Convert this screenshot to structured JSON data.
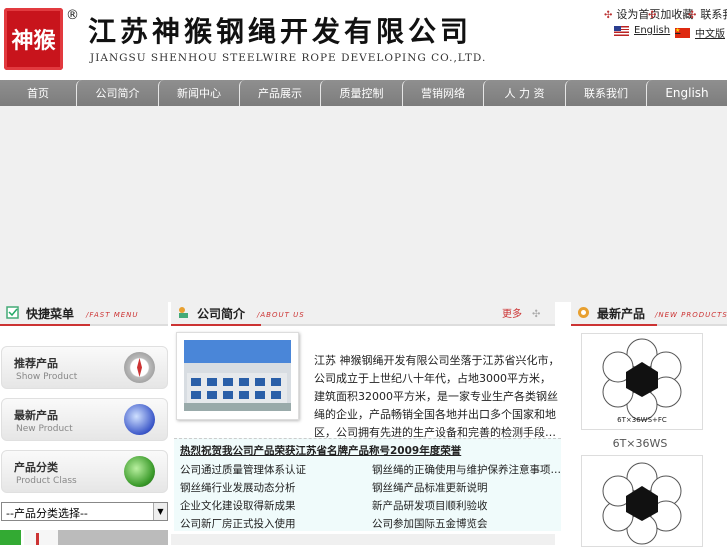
{
  "header": {
    "seal_text": "神猴",
    "reg_mark": "®",
    "company_cn": "江苏神猴钢绳开发有限公司",
    "company_en": "JIANGSU SHENHOU STEELWIRE ROPE DEVELOPING CO.,LTD.",
    "top_links": [
      "设为首页",
      "加收藏",
      "联系我们"
    ],
    "lang_en": "English",
    "lang_cn": "中文版"
  },
  "nav": {
    "items": [
      "首页",
      "公司简介",
      "新闻中心",
      "产品展示",
      "质量控制",
      "营销网络",
      "人 力 资",
      "联系我们"
    ],
    "english": "English"
  },
  "left": {
    "title": "快捷菜单",
    "subtitle": "/FAST MENU",
    "cards": [
      {
        "cn": "推荐产品",
        "en": "Show Product"
      },
      {
        "cn": "最新产品",
        "en": "New Product"
      },
      {
        "cn": "产品分类",
        "en": "Product Class"
      }
    ],
    "select_value": "--产品分类选择--"
  },
  "about": {
    "title": "公司简介",
    "subtitle": "/ABOUT US",
    "more": "更多",
    "text": "江苏 神猴钢绳开发有限公司坐落于江苏省兴化市，公司成立于上世纪八十年代，占地3000平方米，建筑面积32000平方米，是一家专业生产各类钢丝绳的企业，产品畅销全国各地并出口多个国家和地区，公司拥有先进的生产设备和完善的检测手段…",
    "news_headline": "热烈祝贺我公司产品荣获江苏省名牌产品称号2009年度荣誉",
    "news_left": [
      "公司通过质量管理体系认证",
      "钢丝绳行业发展动态分析",
      "企业文化建设取得新成果",
      "公司新厂房正式投入使用"
    ],
    "news_right": [
      "钢丝绳的正确使用与维护保养注意事项…",
      "钢丝绳产品标准更新说明",
      "新产品研发项目顺利验收",
      "公司参加国际五金博览会"
    ]
  },
  "right": {
    "title": "最新产品",
    "subtitle": "/NEW PRODUCTS",
    "products": [
      {
        "name": "6T×36WS",
        "caption": "6T×36WS+FC"
      },
      {
        "name": "",
        "caption": ""
      }
    ]
  },
  "colors": {
    "accent": "#cc3333",
    "nav": "#8a8a8a",
    "seal": "#c8141c"
  }
}
